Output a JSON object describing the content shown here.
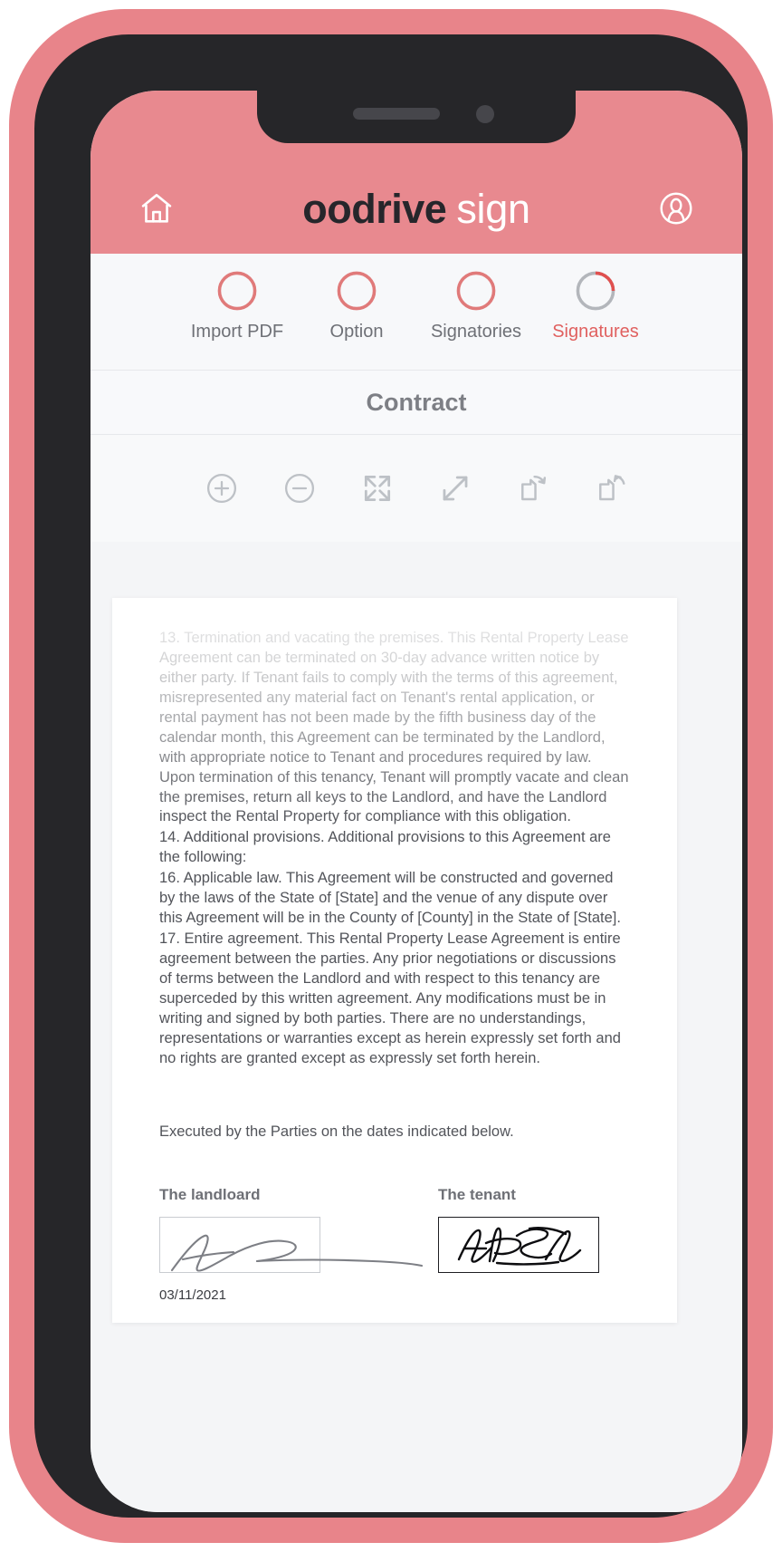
{
  "app": {
    "brand_primary": "oodrive",
    "brand_secondary": "sign",
    "home_icon": "home-icon",
    "account_icon": "account-avatar-icon",
    "header_color": "#e8898f",
    "accent_color": "#e0605f"
  },
  "stepper": {
    "steps": [
      {
        "label": "Import PDF",
        "state": "complete",
        "progress": 100,
        "color": "#e07a7a"
      },
      {
        "label": "Option",
        "state": "complete",
        "progress": 100,
        "color": "#e07a7a"
      },
      {
        "label": "Signatories",
        "state": "complete",
        "progress": 100,
        "color": "#e07a7a"
      },
      {
        "label": "Signatures",
        "state": "active",
        "progress": 25,
        "color": "#e0504f",
        "track_color": "#b3b6bb"
      }
    ]
  },
  "document": {
    "title": "Contract",
    "toolbar": [
      {
        "name": "zoom-in-icon",
        "label": "Zoom in"
      },
      {
        "name": "zoom-out-icon",
        "label": "Zoom out"
      },
      {
        "name": "fit-screen-icon",
        "label": "Fit to screen"
      },
      {
        "name": "expand-diagonal-icon",
        "label": "Expand"
      },
      {
        "name": "rotate-right-icon",
        "label": "Rotate right"
      },
      {
        "name": "rotate-left-icon",
        "label": "Rotate left"
      }
    ],
    "paragraphs": [
      "13. Termination and vacating the premises.  This Rental Property Lease Agreement can be terminated on 30-day advance written notice by either party.  If Tenant fails to comply with the terms of this agreement, misrepresented any material fact on Tenant's rental application, or rental payment has not been made by the fifth business day of the calendar month, this Agreement can be terminated by the Landlord, with appropriate notice to Tenant and procedures required by law.  Upon termination of this tenancy, Tenant will promptly vacate and clean the premises, return all keys to the Landlord, and have the Landlord inspect the Rental Property for compliance with this obligation.",
      "14. Additional provisions.  Additional provisions to this Agreement are the following:",
      "16. Applicable law.  This Agreement will be constructed and governed by the laws of the State of [State] and the venue of any dispute over this Agreement will be in the County of [County] in the State of [State].",
      "17. Entire agreement.  This Rental Property Lease Agreement is entire agreement between the parties.  Any prior negotiations or discussions of terms between the Landlord and with respect to this tenancy are superceded by this written agreement. Any modifications must be in writing and signed by both parties. There are no understandings, representations or warranties except as herein expressly set forth and no rights are granted except as expressly set forth herein."
    ],
    "executed_line": "Executed by the Parties on the dates indicated below.",
    "signatures": {
      "landlord": {
        "heading": "The landloard",
        "date": "03/11/2021",
        "signed": true
      },
      "tenant": {
        "heading": "The tenant",
        "date": "",
        "signed": true
      }
    }
  }
}
